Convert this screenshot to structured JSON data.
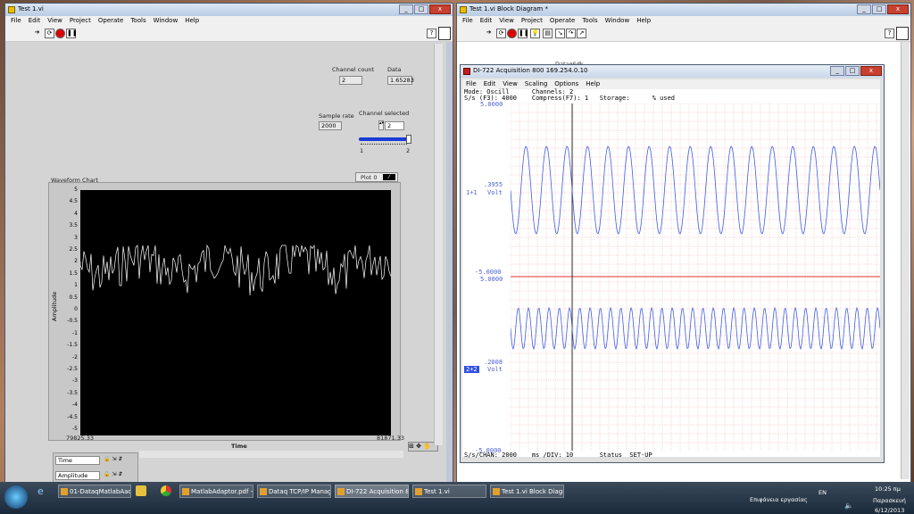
{
  "front_panel": {
    "title": "Test 1.vi",
    "menu": [
      "File",
      "Edit",
      "View",
      "Project",
      "Operate",
      "Tools",
      "Window",
      "Help"
    ],
    "channel_count": {
      "label": "Channel count",
      "value": "2"
    },
    "data": {
      "label": "Data",
      "value": "1.65283"
    },
    "sample_rate": {
      "label": "Sample rate",
      "value": "2000"
    },
    "channel_selected": {
      "label": "Channel selected",
      "value": "2",
      "slider_min": "1",
      "slider_max": "2",
      "slider_level": 1.0
    },
    "chart": {
      "title": "Waveform Chart",
      "legend": "Plot 0",
      "ylabel": "Amplitude",
      "xlabel": "Time",
      "x_start": "79825.33",
      "x_end": "81871.33",
      "yticks": [
        "5",
        "4.5",
        "4",
        "3.5",
        "3",
        "2.5",
        "2",
        "1.5",
        "1",
        "0.5",
        "0",
        "-0.5",
        "-1",
        "-1.5",
        "-2",
        "-2.5",
        "-3",
        "-3.5",
        "-4",
        "-4.5",
        "-5"
      ]
    },
    "scale_legend": {
      "time": "Time",
      "amplitude": "Amplitude"
    }
  },
  "block_diagram": {
    "title": "Test 1.vi Block Diagram *",
    "menu": [
      "File",
      "Edit",
      "View",
      "Project",
      "Operate",
      "Tools",
      "Window",
      "Help"
    ],
    "node_label": "DataqSdk"
  },
  "dataq": {
    "title": "DI-722 Acquisition 800 169.254.0.10",
    "menu": [
      "File",
      "Edit",
      "View",
      "Scaling",
      "Options",
      "Help"
    ],
    "header_line1": "Mode: Oscill      Channels: 2",
    "header_line2": "S/s (F3): 4000    Compress(F7): 1   Storage:      % used",
    "ch1": {
      "top": "5.0000",
      "bottom": "-5.0000",
      "value": ".3955",
      "name": "1+1",
      "unit": "Volt"
    },
    "ch2": {
      "top": "5.0000",
      "bottom": "-5.0000",
      "value": ".2008",
      "name": "2+2",
      "unit": "Volt"
    },
    "status_line": "S/s/CHAN: 2000    ms /DIV: 10       Status  SET-UP"
  },
  "taskbar": {
    "tasks": [
      "01-DataqMatlabAad...",
      "",
      "",
      "MatlabAdaptor.pdf -...",
      "Dataq TCP/IP Manag...",
      "DI-722 Acquisition 8...",
      "Test 1.vi",
      "Test 1.vi Block Diagr..."
    ],
    "tray_text": "Επιφάνεια εργασίας",
    "lang": "EN",
    "time": "10:25 πμ",
    "day": "Παρασκευή",
    "date": "6/12/2013"
  }
}
